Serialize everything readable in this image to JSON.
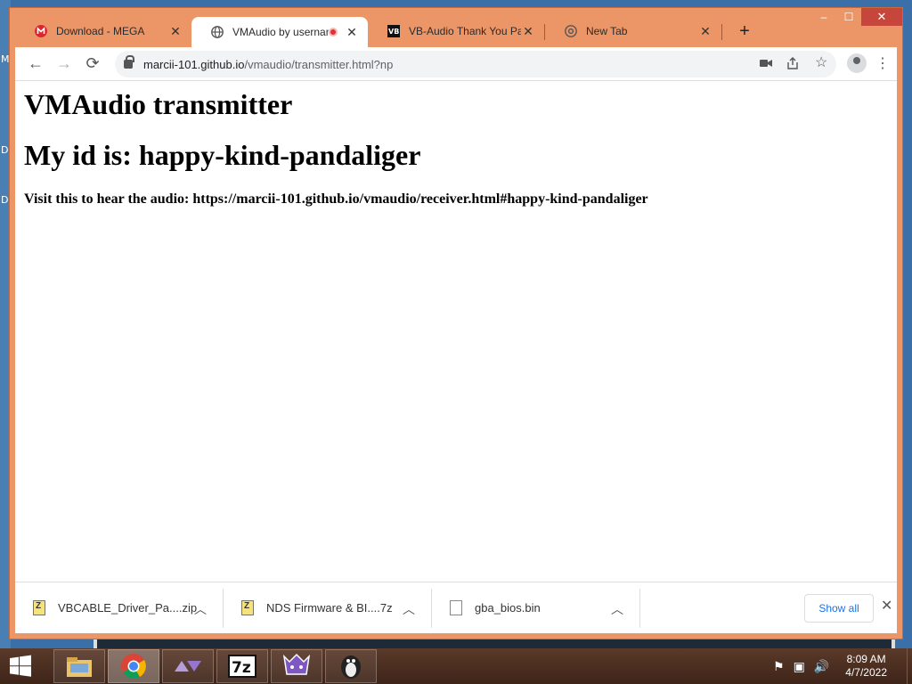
{
  "desktop": {
    "edge_chars": [
      "M",
      "D",
      "D"
    ]
  },
  "browser": {
    "tabs": [
      {
        "title": "Download - MEGA",
        "icon": "mega-icon",
        "color": "#d9272e"
      },
      {
        "title": "VMAudio by usernam",
        "icon": "globe-icon",
        "active": true,
        "recording": true
      },
      {
        "title": "VB-Audio Thank You Pag",
        "icon": "vb-audio-icon"
      },
      {
        "title": "New Tab",
        "icon": "chrome-icon"
      }
    ],
    "window_controls": {
      "minimize": "–",
      "maximize": "☐",
      "close": "✕"
    },
    "url_host": "marcii-101.github.io",
    "url_path": "/vmaudio/transmitter.html?np"
  },
  "page": {
    "heading": "VMAudio transmitter",
    "id_heading": "My id is: happy-kind-pandaliger",
    "visit_text": "Visit this to hear the audio: https://marcii-101.github.io/vmaudio/receiver.html#happy-kind-pandaliger"
  },
  "downloads": {
    "items": [
      {
        "name": "VBCABLE_Driver_Pa....zip",
        "icon": "zip-file-icon"
      },
      {
        "name": "NDS Firmware & BI....7z",
        "icon": "zip-file-icon"
      },
      {
        "name": "gba_bios.bin",
        "icon": "file-icon"
      }
    ],
    "show_all": "Show all"
  },
  "taskbar": {
    "apps": [
      "file-explorer-icon",
      "chrome-icon",
      "arrows-app-icon",
      "7zip-icon",
      "game-app-icon",
      "tux-app-icon"
    ],
    "time": "8:09 AM",
    "date": "4/7/2022"
  }
}
